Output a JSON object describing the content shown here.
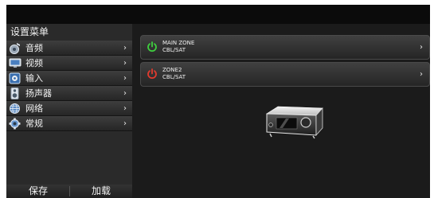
{
  "sidebar": {
    "title": "设置菜单",
    "items": [
      {
        "label": "音频",
        "icon": "audio-icon"
      },
      {
        "label": "视频",
        "icon": "video-icon"
      },
      {
        "label": "输入",
        "icon": "input-icon"
      },
      {
        "label": "扬声器",
        "icon": "speaker-icon"
      },
      {
        "label": "网络",
        "icon": "network-icon"
      },
      {
        "label": "常规",
        "icon": "gear-icon"
      }
    ],
    "chevron": "›",
    "save_label": "保存",
    "load_label": "加载"
  },
  "zones": [
    {
      "name": "MAIN ZONE",
      "source": "CBL/SAT",
      "power": "on",
      "power_color": "#3fcf3f"
    },
    {
      "name": "ZONE2",
      "source": "CBL/SAT",
      "power": "off",
      "power_color": "#e23a2e"
    }
  ],
  "colors": {
    "background": "#1b1b1b",
    "sidebar": "#2a2a2a",
    "topbar": "#0b0b0b"
  }
}
